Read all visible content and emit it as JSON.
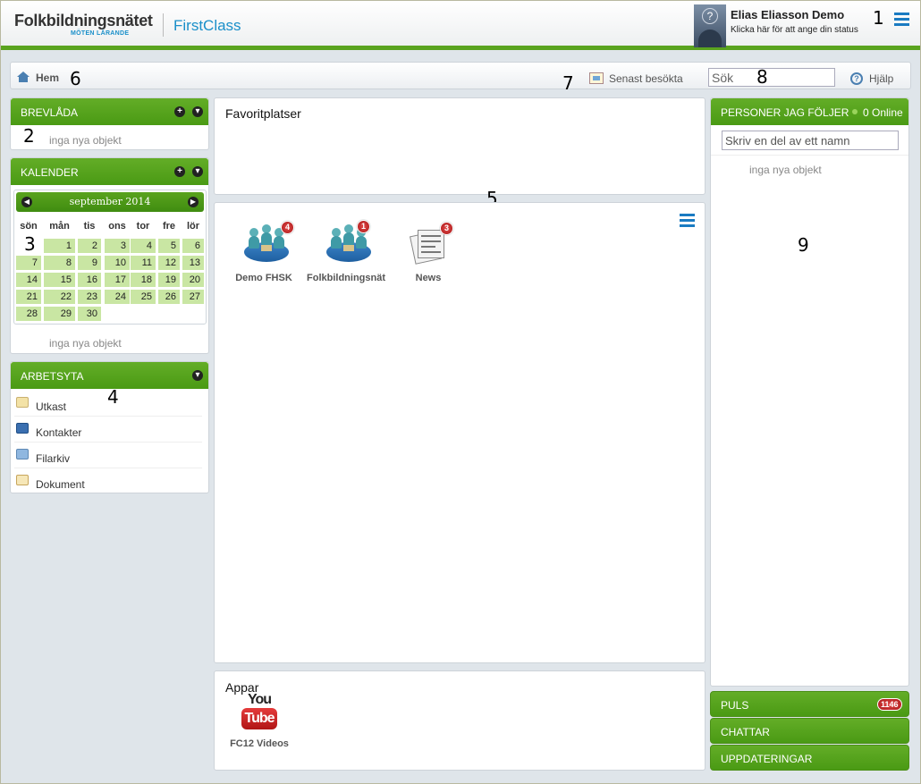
{
  "header": {
    "logo_main": "Folkbildningsnätet",
    "logo_sub": "MÖTEN  LÄRANDE",
    "product": "FirstClass",
    "user_name": "Elias Eliasson Demo",
    "user_status": "Klicka här för att ange din status"
  },
  "annotations": [
    "1",
    "2",
    "3",
    "4",
    "5",
    "6",
    "7",
    "8",
    "9"
  ],
  "nav": {
    "home": "Hem",
    "recent": "Senast besökta",
    "search_placeholder": "Sök",
    "help": "Hjälp"
  },
  "mailbox": {
    "title": "BREVLÅDA",
    "empty": "inga nya objekt"
  },
  "calendar": {
    "title": "KALENDER",
    "month": "september 2014",
    "weekdays": [
      "sön",
      "mån",
      "tis",
      "ons",
      "tor",
      "fre",
      "lör"
    ],
    "days": [
      "1",
      "2",
      "3",
      "4",
      "5",
      "6",
      "7",
      "8",
      "9",
      "10",
      "11",
      "12",
      "13",
      "14",
      "15",
      "16",
      "17",
      "18",
      "19",
      "20",
      "21",
      "22",
      "23",
      "24",
      "25",
      "26",
      "27",
      "28",
      "29",
      "30"
    ],
    "empty": "inga nya objekt"
  },
  "workspace": {
    "title": "ARBETSYTA",
    "items": [
      "Utkast",
      "Kontakter",
      "Filarkiv",
      "Dokument"
    ]
  },
  "favorites": {
    "title": "Favoritplatser"
  },
  "desktop": {
    "tiles": [
      {
        "label": "Demo FHSK",
        "badge": "4"
      },
      {
        "label": "Folkbildningsnät",
        "badge": "1"
      },
      {
        "label": "News",
        "badge": "3"
      }
    ]
  },
  "apps": {
    "title": "Appar",
    "items": [
      {
        "label": "FC12 Videos",
        "logo_top": "You",
        "logo_bottom": "Tube"
      }
    ]
  },
  "people": {
    "title": "PERSONER JAG FÖLJER",
    "online": "0 Online",
    "search_placeholder": "Skriv en del av ett namn",
    "empty": "inga nya objekt"
  },
  "bottom_bars": {
    "puls": "PULS",
    "puls_badge": "1146",
    "chat": "CHATTAR",
    "updates": "UPPDATERINGAR"
  },
  "colors": {
    "accent_green": "#5aa31e",
    "link_blue": "#1a8fc9",
    "badge_red": "#c62020",
    "day_green": "#c9e6a3"
  }
}
